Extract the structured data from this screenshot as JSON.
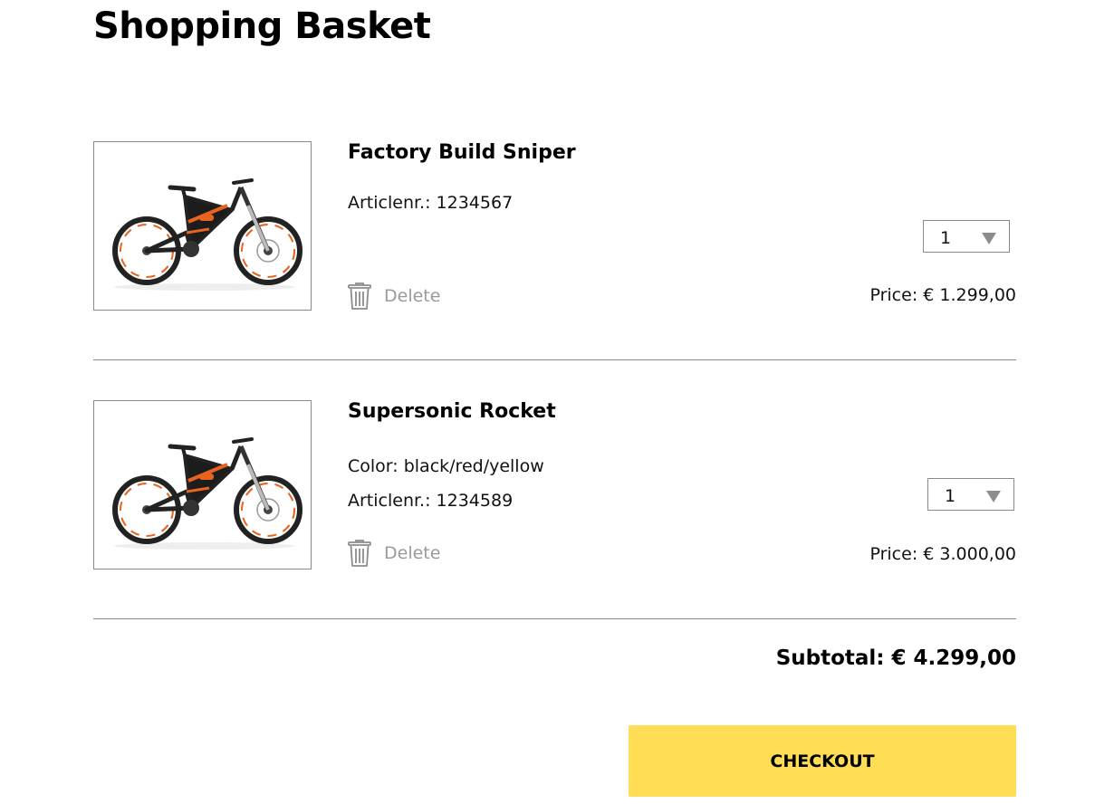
{
  "page": {
    "title": "Shopping Basket"
  },
  "items": [
    {
      "name": "Factory Build Sniper",
      "details": [
        "Articlenr.: 1234567"
      ],
      "delete_label": "Delete",
      "quantity": "1",
      "price": "Price: € 1.299,00",
      "image_icon": "mountain-bike-photo"
    },
    {
      "name": "Supersonic Rocket",
      "details": [
        "Color: black/red/yellow",
        "Articlenr.: 1234589"
      ],
      "delete_label": "Delete",
      "quantity": "1",
      "price": "Price: € 3.000,00",
      "image_icon": "mountain-bike-photo"
    }
  ],
  "summary": {
    "subtotal": "Subtotal: € 4.299,00",
    "checkout_label": "CHECKOUT"
  },
  "icons": {
    "delete": "trash-icon",
    "quantity_dropdown": "triangle-down-icon"
  },
  "colors": {
    "checkout_bg": "#ffdd55",
    "bike_accent": "#e8631d",
    "muted_text": "#9a9a9a",
    "border": "#8a8a8a"
  }
}
